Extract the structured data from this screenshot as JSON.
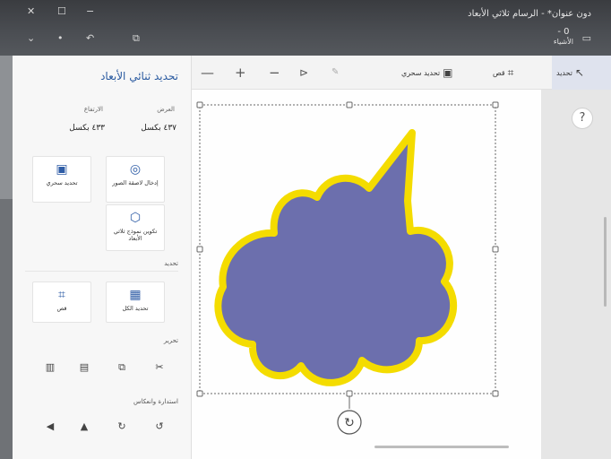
{
  "window": {
    "title": "دون عنوان* - الرسام ثلاثي الأبعاد",
    "zoom_value": "- 0",
    "zoom_label": "الأشياء"
  },
  "toolbar": {
    "select_label": "تحديد",
    "crop_label": "قص",
    "magic_select_label": "تحديد سحري"
  },
  "panel": {
    "title": "تحديد ثنائي الأبعاد",
    "width_label": "العرض",
    "width_value": "٤٣٧ بكسل",
    "height_label": "الارتفاع",
    "height_value": "٤٣٣ بكسل",
    "remove_bg_label": "إدخال لاصقة الصور",
    "magic_select_label": "تحديد سحري",
    "make3d_label": "تكوين نموذج ثلاثي الأبعاد",
    "select_section": "تحديد",
    "select_all_label": "تحديد الكل",
    "crop_label": "قص",
    "edit_section": "تحرير",
    "rotate_section": "استدارة وانعكاس"
  },
  "colors": {
    "cloud_fill": "#6c6fad",
    "cloud_outline": "#f4dc00",
    "accent": "#2f5da6"
  },
  "icons": {
    "select": "cursor-icon",
    "crop": "crop-icon",
    "magic_select": "magic-select-icon",
    "help": "?",
    "rotate": "↻"
  }
}
